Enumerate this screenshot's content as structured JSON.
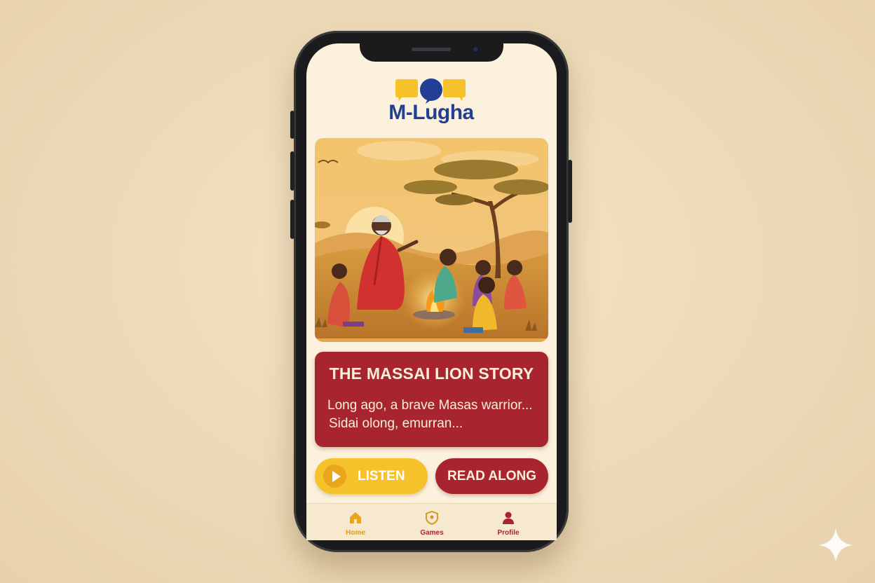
{
  "app": {
    "name": "M-Lugha"
  },
  "story": {
    "title": "THE MASSAI LION STORY",
    "line1": "Long ago, a brave Masas warrior...",
    "line2": "Sidai olong, emurran..."
  },
  "actions": {
    "listen_label": "LISTEN",
    "read_along_label": "READ ALONG"
  },
  "tabbar": {
    "items": [
      {
        "label": "Home",
        "icon": "home-icon"
      },
      {
        "label": "Games",
        "icon": "shield-icon"
      },
      {
        "label": "Profile",
        "icon": "person-icon"
      }
    ]
  },
  "colors": {
    "brand_blue": "#233f95",
    "brand_yellow": "#f6c22c",
    "brand_red": "#a8252f",
    "screen_bg": "#fbf1dc"
  }
}
